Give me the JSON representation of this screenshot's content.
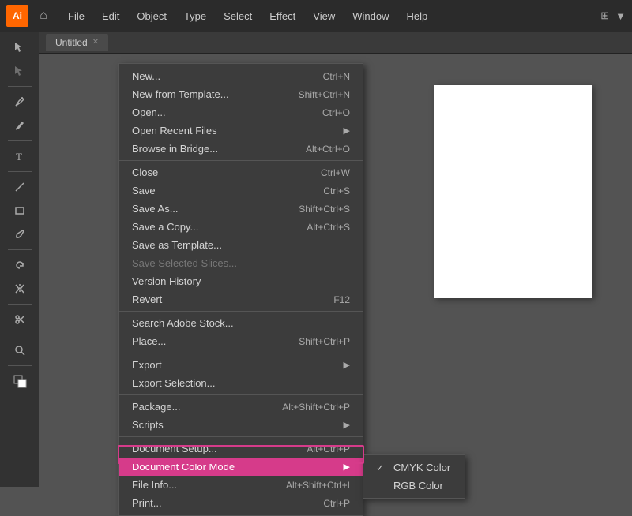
{
  "app": {
    "logo": "Ai",
    "title": "Untitled"
  },
  "menubar": {
    "items": [
      "File",
      "Edit",
      "Object",
      "Type",
      "Select",
      "Effect",
      "View",
      "Window",
      "Help"
    ]
  },
  "file_menu": {
    "items": [
      {
        "label": "New...",
        "shortcut": "Ctrl+N",
        "disabled": false,
        "has_arrow": false
      },
      {
        "label": "New from Template...",
        "shortcut": "Shift+Ctrl+N",
        "disabled": false,
        "has_arrow": false
      },
      {
        "label": "Open...",
        "shortcut": "Ctrl+O",
        "disabled": false,
        "has_arrow": false
      },
      {
        "label": "Open Recent Files",
        "shortcut": "",
        "disabled": false,
        "has_arrow": true
      },
      {
        "label": "Browse in Bridge...",
        "shortcut": "Alt+Ctrl+O",
        "disabled": false,
        "has_arrow": false
      },
      {
        "separator": true
      },
      {
        "label": "Close",
        "shortcut": "Ctrl+W",
        "disabled": false,
        "has_arrow": false
      },
      {
        "label": "Save",
        "shortcut": "Ctrl+S",
        "disabled": false,
        "has_arrow": false
      },
      {
        "label": "Save As...",
        "shortcut": "Shift+Ctrl+S",
        "disabled": false,
        "has_arrow": false
      },
      {
        "label": "Save a Copy...",
        "shortcut": "Alt+Ctrl+S",
        "disabled": false,
        "has_arrow": false
      },
      {
        "label": "Save as Template...",
        "shortcut": "",
        "disabled": false,
        "has_arrow": false
      },
      {
        "label": "Save Selected Slices...",
        "shortcut": "",
        "disabled": true,
        "has_arrow": false
      },
      {
        "label": "Version History",
        "shortcut": "",
        "disabled": false,
        "has_arrow": false
      },
      {
        "label": "Revert",
        "shortcut": "F12",
        "disabled": false,
        "has_arrow": false
      },
      {
        "separator": true
      },
      {
        "label": "Search Adobe Stock...",
        "shortcut": "",
        "disabled": false,
        "has_arrow": false
      },
      {
        "label": "Place...",
        "shortcut": "Shift+Ctrl+P",
        "disabled": false,
        "has_arrow": false
      },
      {
        "separator": true
      },
      {
        "label": "Export",
        "shortcut": "",
        "disabled": false,
        "has_arrow": true
      },
      {
        "label": "Export Selection...",
        "shortcut": "",
        "disabled": false,
        "has_arrow": false
      },
      {
        "separator": true
      },
      {
        "label": "Package...",
        "shortcut": "Alt+Shift+Ctrl+P",
        "disabled": false,
        "has_arrow": false
      },
      {
        "label": "Scripts",
        "shortcut": "",
        "disabled": false,
        "has_arrow": true
      },
      {
        "separator": true
      },
      {
        "label": "Document Setup...",
        "shortcut": "Alt+Ctrl+P",
        "disabled": false,
        "has_arrow": false
      },
      {
        "label": "Document Color Mode",
        "shortcut": "",
        "disabled": false,
        "has_arrow": true,
        "highlighted": true
      },
      {
        "label": "File Info...",
        "shortcut": "Alt+Shift+Ctrl+I",
        "disabled": false,
        "has_arrow": false
      },
      {
        "label": "Print...",
        "shortcut": "Ctrl+P",
        "disabled": false,
        "has_arrow": false
      }
    ]
  },
  "color_mode_submenu": {
    "items": [
      {
        "label": "CMYK Color",
        "checked": true
      },
      {
        "label": "RGB Color",
        "checked": false
      }
    ]
  },
  "tools": [
    "▶",
    "↖",
    "⬡",
    "✏",
    "T",
    "↺",
    "■",
    "⟡",
    "✂",
    "🔍",
    "⬛",
    "🎨"
  ]
}
